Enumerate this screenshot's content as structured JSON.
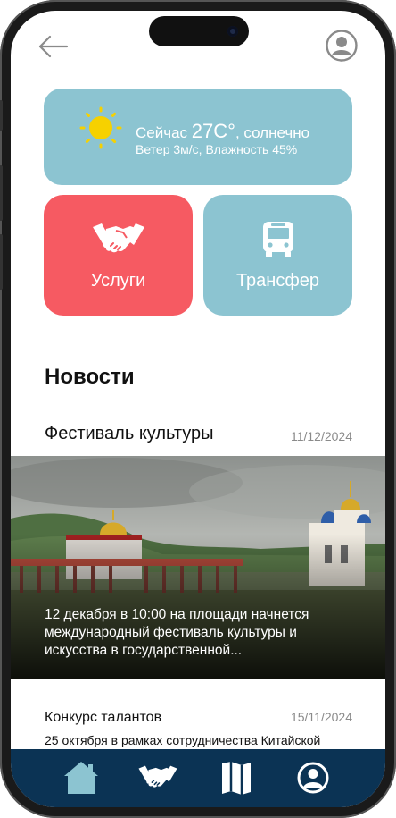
{
  "weather": {
    "prefix": "Сейчас",
    "temp": "27C°",
    "condition": ", солнечно",
    "details": "Ветер 3м/с, Влажность 45%",
    "icon": "sun-icon"
  },
  "tiles": {
    "services": {
      "label": "Услуги",
      "icon": "handshake-icon",
      "color": "#f65a62"
    },
    "transfer": {
      "label": "Трансфер",
      "icon": "bus-icon",
      "color": "#8cc4d1"
    }
  },
  "news": {
    "heading": "Новости",
    "items": [
      {
        "title": "Фестиваль культуры",
        "date": "11/12/2024",
        "caption": "12 декабря в 10:00 на площади начнется международный фестиваль культуры и искусства в государственной..."
      },
      {
        "title": "Конкурс талантов",
        "date": "15/11/2024",
        "snippet": "25 октября в рамках сотрудничества Китайской"
      }
    ]
  },
  "tab_bar": {
    "color": "#0b3354",
    "tabs": [
      "home-icon",
      "handshake-icon",
      "map-icon",
      "profile-icon"
    ]
  }
}
